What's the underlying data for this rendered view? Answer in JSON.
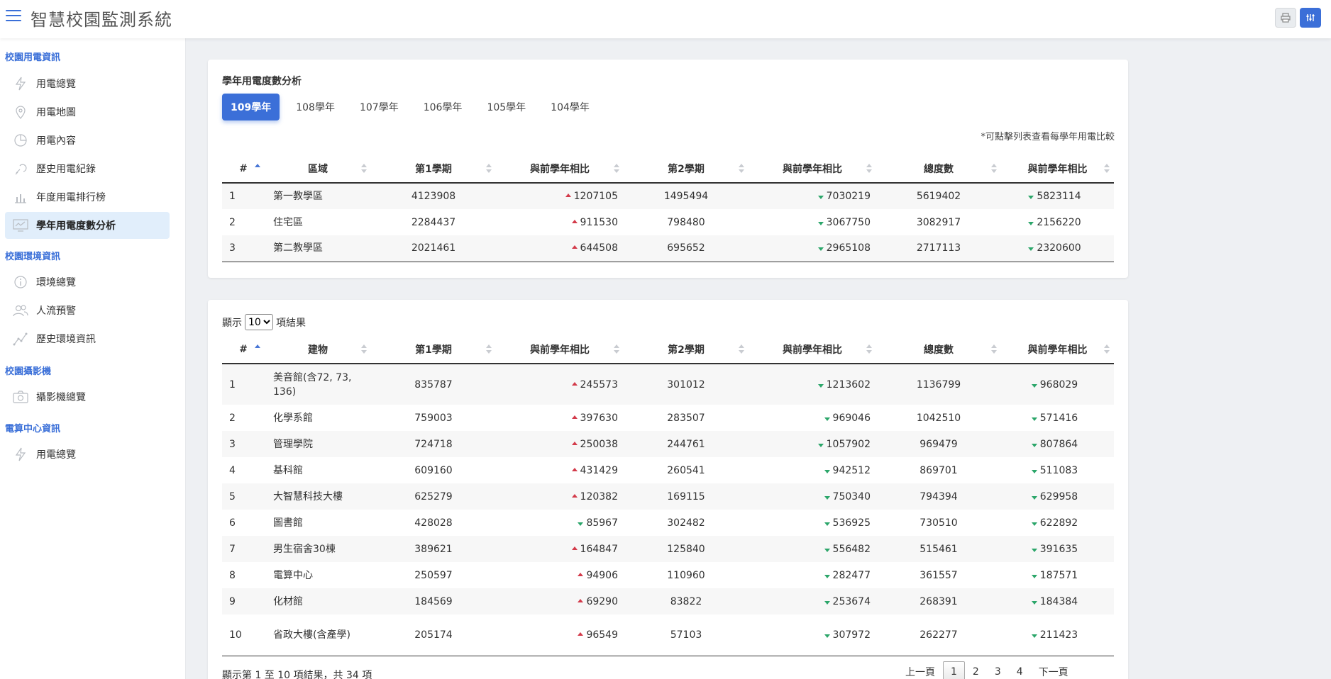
{
  "app": {
    "title": "智慧校園監測系統"
  },
  "sidebar": {
    "sections": [
      {
        "title": "校園用電資訊",
        "items": [
          {
            "label": "用電總覽",
            "icon": "lightning-icon"
          },
          {
            "label": "用電地圖",
            "icon": "map-pin-icon"
          },
          {
            "label": "用電內容",
            "icon": "pie-chart-icon"
          },
          {
            "label": "歷史用電紀錄",
            "icon": "history-icon"
          },
          {
            "label": "年度用電排行榜",
            "icon": "bar-chart-icon"
          },
          {
            "label": "學年用電度數分析",
            "icon": "monitor-chart-icon",
            "active": true
          }
        ]
      },
      {
        "title": "校園環境資訊",
        "items": [
          {
            "label": "環境總覽",
            "icon": "info-icon"
          },
          {
            "label": "人流預警",
            "icon": "people-icon"
          },
          {
            "label": "歷史環境資訊",
            "icon": "trend-line-icon"
          }
        ]
      },
      {
        "title": "校園攝影機",
        "items": [
          {
            "label": "攝影機總覽",
            "icon": "camera-icon"
          }
        ]
      },
      {
        "title": "電算中心資訊",
        "items": [
          {
            "label": "用電總覽",
            "icon": "lightning-icon"
          }
        ]
      }
    ]
  },
  "summary": {
    "title": "學年用電度數分析",
    "tabs": [
      "109學年",
      "108學年",
      "107學年",
      "106學年",
      "105學年",
      "104學年"
    ],
    "active_tab": "109學年",
    "note": "*可點擊列表查看每學年用電比較",
    "headers": [
      "#",
      "區域",
      "第1學期",
      "與前學年相比",
      "第2學期",
      "與前學年相比",
      "總度數",
      "與前學年相比"
    ],
    "rows": [
      [
        "1",
        "第一教學區",
        "4123908",
        "1207105",
        "1495494",
        "7030219",
        "5619402",
        "5823114"
      ],
      [
        "2",
        "住宅區",
        "2284437",
        "911530",
        "798480",
        "3067750",
        "3082917",
        "2156220"
      ],
      [
        "3",
        "第二教學區",
        "2021461",
        "644508",
        "695652",
        "2965108",
        "2717113",
        "2320600"
      ]
    ],
    "trend": [
      [
        "up",
        "down",
        "down"
      ],
      [
        "up",
        "down",
        "down"
      ],
      [
        "up",
        "down",
        "down"
      ]
    ]
  },
  "buildings": {
    "length_label_pre": "顯示",
    "length_value": "10",
    "length_label_post": "項結果",
    "headers": [
      "#",
      "建物",
      "第1學期",
      "與前學年相比",
      "第2學期",
      "與前學年相比",
      "總度數",
      "與前學年相比"
    ],
    "rows": [
      [
        "1",
        "美音館(含72, 73, 136)",
        "835787",
        "245573",
        "301012",
        "1213602",
        "1136799",
        "968029"
      ],
      [
        "2",
        "化學系館",
        "759003",
        "397630",
        "283507",
        "969046",
        "1042510",
        "571416"
      ],
      [
        "3",
        "管理學院",
        "724718",
        "250038",
        "244761",
        "1057902",
        "969479",
        "807864"
      ],
      [
        "4",
        "基科館",
        "609160",
        "431429",
        "260541",
        "942512",
        "869701",
        "511083"
      ],
      [
        "5",
        "大智慧科技大樓",
        "625279",
        "120382",
        "169115",
        "750340",
        "794394",
        "629958"
      ],
      [
        "6",
        "圖書館",
        "428028",
        "85967",
        "302482",
        "536925",
        "730510",
        "622892"
      ],
      [
        "7",
        "男生宿舍30棟",
        "389621",
        "164847",
        "125840",
        "556482",
        "515461",
        "391635"
      ],
      [
        "8",
        "電算中心",
        "250597",
        "94906",
        "110960",
        "282477",
        "361557",
        "187571"
      ],
      [
        "9",
        "化材館",
        "184569",
        "69290",
        "83822",
        "253674",
        "268391",
        "184384"
      ],
      [
        "10",
        "省政大樓(含產學)",
        "205174",
        "96549",
        "57103",
        "307972",
        "262277",
        "211423"
      ]
    ],
    "trend": [
      [
        "up",
        "down",
        "down"
      ],
      [
        "up",
        "down",
        "down"
      ],
      [
        "up",
        "down",
        "down"
      ],
      [
        "up",
        "down",
        "down"
      ],
      [
        "up",
        "down",
        "down"
      ],
      [
        "down",
        "down",
        "down"
      ],
      [
        "up",
        "down",
        "down"
      ],
      [
        "up",
        "down",
        "down"
      ],
      [
        "up",
        "down",
        "down"
      ],
      [
        "up",
        "down",
        "down"
      ]
    ],
    "info": "顯示第 1 至 10 項結果，共 34 項",
    "pager": {
      "prev": "上一頁",
      "pages": [
        "1",
        "2",
        "3",
        "4"
      ],
      "current": "1",
      "next": "下一頁"
    }
  },
  "colors": {
    "accent": "#3b6fd8",
    "up": "#d33a4a",
    "down": "#2ca66a",
    "active_bg": "#e1eefb"
  }
}
